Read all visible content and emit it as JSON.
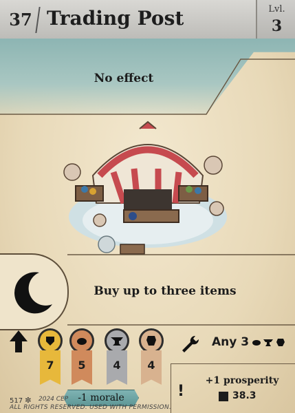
{
  "card": {
    "number": "37",
    "title": "Trading Post",
    "level_label": "Lvl.",
    "level": "3"
  },
  "effects": {
    "top": "No effect",
    "bottom": "Buy up to three items"
  },
  "icons": {
    "night": "crescent-moon-icon",
    "upgrade": "up-arrow-icon",
    "tool": "wrench-icon"
  },
  "shop": {
    "prices": [
      {
        "resource": "metal-icon",
        "value": "7",
        "color": "#e7b83b"
      },
      {
        "resource": "hide-icon",
        "value": "5",
        "color": "#d08a5c"
      },
      {
        "resource": "anvil-icon",
        "value": "4",
        "color": "#a9aaad"
      },
      {
        "resource": "leather-icon",
        "value": "4",
        "color": "#d8b28f"
      }
    ],
    "any_label": "Any 3"
  },
  "footer": {
    "prosperity": "+1 prosperity",
    "book_value": "38.3",
    "morale": "-1 morale",
    "card_id": "517",
    "copyright_year": "2024 CEP",
    "copyright_rights": "ALL RIGHTS RESERVED. USED WITH PERMISSION."
  },
  "colors": {
    "header": "#cfcecb",
    "teal": "#8db5b3",
    "parchment": "#ecdfc4",
    "tent_red": "#c64a4f"
  }
}
